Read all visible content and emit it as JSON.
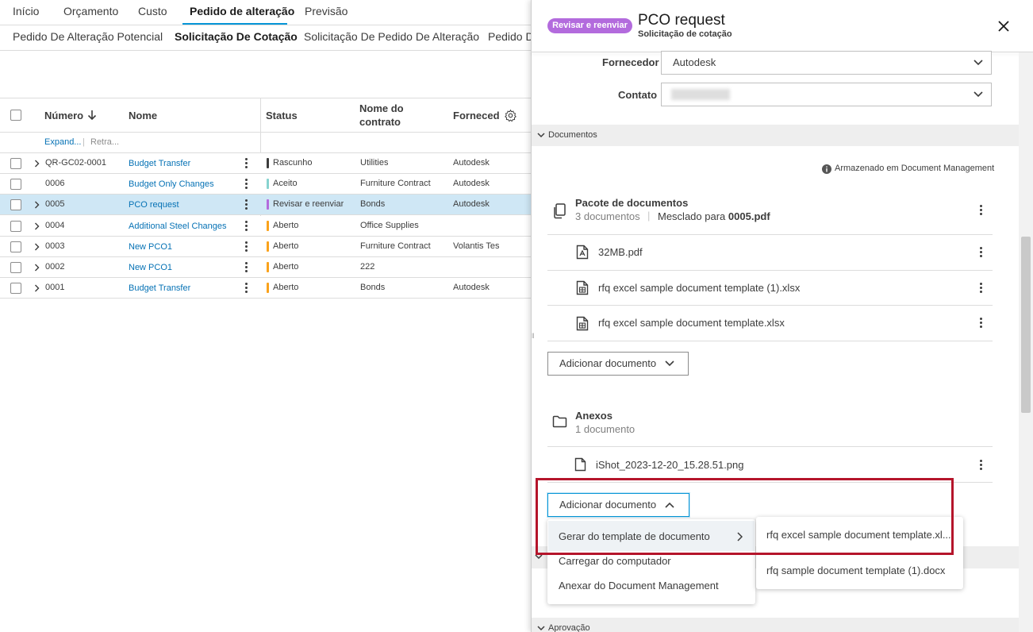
{
  "top_tabs": [
    {
      "label": "Início",
      "active": false
    },
    {
      "label": "Orçamento",
      "active": false
    },
    {
      "label": "Custo",
      "active": false
    },
    {
      "label": "Pedido de alteração",
      "active": true
    },
    {
      "label": "Previsão",
      "active": false
    }
  ],
  "sub_tabs": [
    {
      "label": "Pedido De Alteração Potencial",
      "active": false
    },
    {
      "label": "Solicitação De Cotação",
      "active": true
    },
    {
      "label": "Solicitação De Pedido De Alteração",
      "active": false
    },
    {
      "label": "Pedido De",
      "active": false
    }
  ],
  "table": {
    "headers": {
      "number": "Número",
      "name": "Nome",
      "status": "Status",
      "contract": "Nome do contrato",
      "supplier": "Fornecedo"
    },
    "expand_label": "Expand...",
    "collapse_label": "Retra...",
    "rows": [
      {
        "number": "QR-GC02-0001",
        "name": "Budget Transfer",
        "status": "Rascunho",
        "status_color": "#3c3c3c",
        "contract": "Utilities",
        "supplier": "Autodesk",
        "expandable": true,
        "selected": false
      },
      {
        "number": "0006",
        "name": "Budget Only Changes",
        "status": "Aceito",
        "status_color": "#87d3cf",
        "contract": "Furniture Contract",
        "supplier": "Autodesk",
        "expandable": false,
        "selected": false
      },
      {
        "number": "0005",
        "name": "PCO request",
        "status": "Revisar e reenviar",
        "status_color": "#b36bdd",
        "contract": "Bonds",
        "supplier": "Autodesk",
        "expandable": true,
        "selected": true
      },
      {
        "number": "0004",
        "name": "Additional Steel Changes",
        "status": "Aberto",
        "status_color": "#faa21b",
        "contract": "Office Supplies",
        "supplier": "",
        "expandable": true,
        "selected": false
      },
      {
        "number": "0003",
        "name": "New PCO1",
        "status": "Aberto",
        "status_color": "#faa21b",
        "contract": "Furniture Contract",
        "supplier": "Volantis Tes",
        "expandable": true,
        "selected": false
      },
      {
        "number": "0002",
        "name": "New PCO1",
        "status": "Aberto",
        "status_color": "#faa21b",
        "contract": "222",
        "supplier": "",
        "expandable": true,
        "selected": false
      },
      {
        "number": "0001",
        "name": "Budget Transfer",
        "status": "Aberto",
        "status_color": "#faa21b",
        "contract": "Bonds",
        "supplier": "Autodesk",
        "expandable": true,
        "selected": false
      }
    ]
  },
  "panel": {
    "status_pill": "Revisar e reenviar",
    "title": "PCO request",
    "subtitle": "Solicitação de cotação",
    "fields": {
      "supplier_label": "Fornecedor",
      "supplier_value": "Autodesk",
      "contact_label": "Contato",
      "contact_value": ""
    },
    "documents_section": "Documentos",
    "stored_note": "Armazenado em Document Management",
    "package": {
      "title": "Pacote de documentos",
      "count": "3 documentos",
      "merged_prefix": "Mesclado para",
      "merged_file": "0005.pdf",
      "files": [
        "32MB.pdf",
        "rfq excel sample document template (1).xlsx",
        "rfq excel sample document template.xlsx"
      ]
    },
    "add_document_label": "Adicionar documento",
    "attachments": {
      "title": "Anexos",
      "count": "1 documento",
      "files": [
        "iShot_2023-12-20_15.28.51.png"
      ]
    },
    "add_document_label_2": "Adicionar documento",
    "approval_section": "Aprovação"
  },
  "dropdown_menu": {
    "items": [
      "Gerar do template de documento",
      "Carregar do computador",
      "Anexar do Document Management"
    ]
  },
  "submenu": {
    "items": [
      "rfq excel sample document template.xl...",
      "rfq sample document template (1).docx"
    ]
  },
  "colors": {
    "accent": "#0696d7",
    "link": "#0672b5",
    "selected_row": "#cfe7f5",
    "highlight_box": "#b5152b",
    "pill": "#b36bdd"
  }
}
